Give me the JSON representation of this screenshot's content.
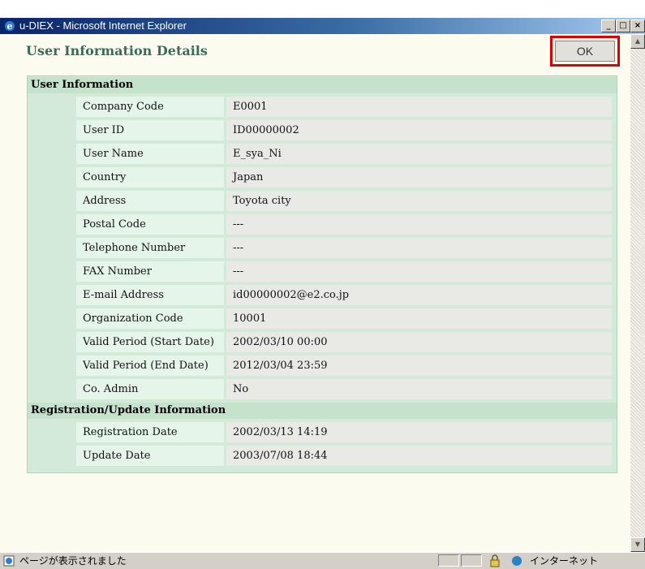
{
  "window": {
    "title": "u-DIEX - Microsoft Internet Explorer"
  },
  "page": {
    "title": "User Information Details",
    "ok_label": "OK"
  },
  "user_section": {
    "heading": "User Information",
    "rows": [
      {
        "label": "Company Code",
        "value": "E0001"
      },
      {
        "label": "User ID",
        "value": "ID00000002"
      },
      {
        "label": "User Name",
        "value": "E_sya_Ni"
      },
      {
        "label": "Country",
        "value": "Japan"
      },
      {
        "label": "Address",
        "value": "Toyota city"
      },
      {
        "label": "Postal Code",
        "value": "---"
      },
      {
        "label": "Telephone Number",
        "value": "---"
      },
      {
        "label": "FAX Number",
        "value": "---"
      },
      {
        "label": "E-mail Address",
        "value": "id00000002@e2.co.jp"
      },
      {
        "label": "Organization Code",
        "value": "10001"
      },
      {
        "label": "Valid Period (Start Date)",
        "value": "2002/03/10 00:00"
      },
      {
        "label": "Valid Period (End Date)",
        "value": "2012/03/04 23:59"
      },
      {
        "label": "Co. Admin",
        "value": "No"
      }
    ]
  },
  "reg_section": {
    "heading": "Registration/Update Information",
    "rows": [
      {
        "label": "Registration Date",
        "value": "2002/03/13 14:19"
      },
      {
        "label": "Update Date",
        "value": "2003/07/08 18:44"
      }
    ]
  },
  "status": {
    "text": "ページが表示されました",
    "zone": "インターネット"
  },
  "colors": {
    "accent_highlight": "#e00000",
    "title_text": "#3a6b5a",
    "panel_bg": "#d4ead9"
  }
}
